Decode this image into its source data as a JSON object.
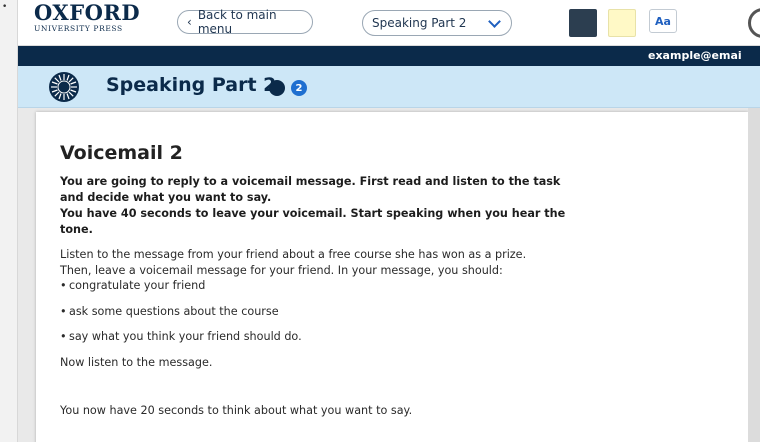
{
  "header": {
    "logo_line1": "OXFORD",
    "logo_line2": "UNIVERSITY PRESS",
    "back_button": "Back to main menu",
    "section_select": "Speaking Part 2",
    "font_button": "Aa",
    "user_email": "example@emai"
  },
  "title_bar": {
    "title": "Speaking Part 2",
    "step_number": "2"
  },
  "task": {
    "heading": "Voicemail 2",
    "instructions": [
      "You are going to reply to a voicemail message. First read and listen to the task and decide what you want to say.",
      "You have 40 seconds to leave your voicemail. Start speaking when you hear the tone."
    ],
    "intro_line1": "Listen to the message from your friend about a free course she has won as a prize.",
    "intro_line2": "Then, leave a voicemail message for your friend. In your message, you should:",
    "bullets": [
      "congratulate your friend",
      "ask some questions about the course",
      "say what you think your friend should do."
    ],
    "now_listen": "Now listen to the message.",
    "think_prompt": "You now have 20 seconds to think about what you want to say."
  },
  "colors": {
    "navy": "#0b2a4a",
    "title_bar_bg": "#cde7f7",
    "accent_blue": "#1f6fd0",
    "theme_dark": "#2c3e50",
    "theme_yellow": "#fff9c6"
  },
  "icons": {
    "back": "chevron-left-icon",
    "select": "chevron-down-icon",
    "brand": "sun-logo-icon"
  }
}
